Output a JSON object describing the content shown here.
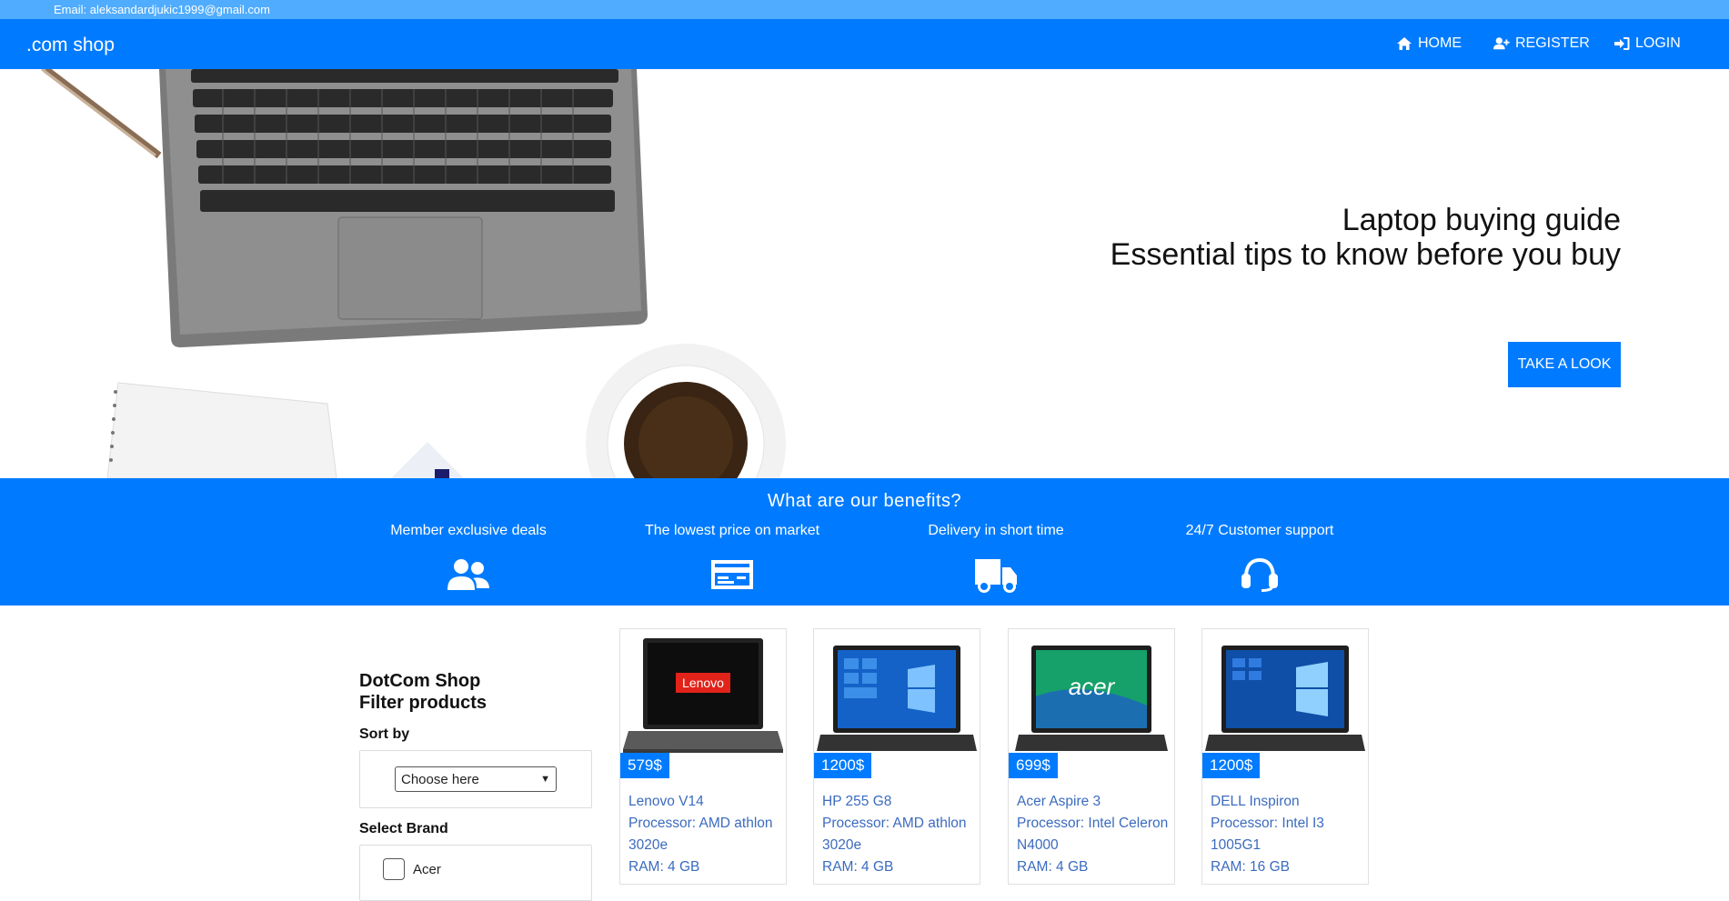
{
  "topbar": {
    "email": "Email: aleksandardjukic1999@gmail.com"
  },
  "nav": {
    "brand": ".com shop",
    "items": [
      {
        "label": "HOME",
        "icon": "home-icon"
      },
      {
        "label": "REGISTER",
        "icon": "user-plus-icon"
      },
      {
        "label": "LOGIN",
        "icon": "sign-in-icon"
      }
    ]
  },
  "hero": {
    "title_line1": "Laptop buying guide",
    "title_line2": "Essential tips to know before you buy",
    "button": "TAKE A LOOK"
  },
  "benefits": {
    "title": "What are our benefits?",
    "items": [
      {
        "label": "Member exclusive deals",
        "icon": "users-icon"
      },
      {
        "label": "The lowest price on market",
        "icon": "credit-card-icon"
      },
      {
        "label": "Delivery in short time",
        "icon": "truck-icon"
      },
      {
        "label": "24/7 Customer support",
        "icon": "headset-icon"
      }
    ]
  },
  "filter": {
    "heading_line1": "DotCom Shop",
    "heading_line2": "Filter products",
    "sort_label": "Sort by",
    "sort_value": "Choose here",
    "brand_label": "Select Brand",
    "brands": [
      "Acer"
    ]
  },
  "products": [
    {
      "price": "579$",
      "name": "Lenovo V14",
      "processor": "Processor: AMD athlon",
      "proc2": "3020e",
      "ram": "RAM: 4 GB",
      "screen_color": "#d10d1f",
      "logo": "Lenovo"
    },
    {
      "price": "1200$",
      "name": "HP 255 G8",
      "processor": "Processor: AMD athlon",
      "proc2": "3020e",
      "ram": "RAM: 4 GB",
      "screen_color": "#1a6fd6",
      "logo": ""
    },
    {
      "price": "699$",
      "name": "Acer Aspire 3",
      "processor": "Processor: Intel Celeron",
      "proc2": "N4000",
      "ram": "RAM: 4 GB",
      "screen_color": "#22b573",
      "logo": "acer"
    },
    {
      "price": "1200$",
      "name": "DELL Inspiron",
      "processor": "Processor: Intel I3",
      "proc2": "1005G1",
      "ram": "RAM: 16 GB",
      "screen_color": "#1a5fc7",
      "logo": ""
    }
  ]
}
